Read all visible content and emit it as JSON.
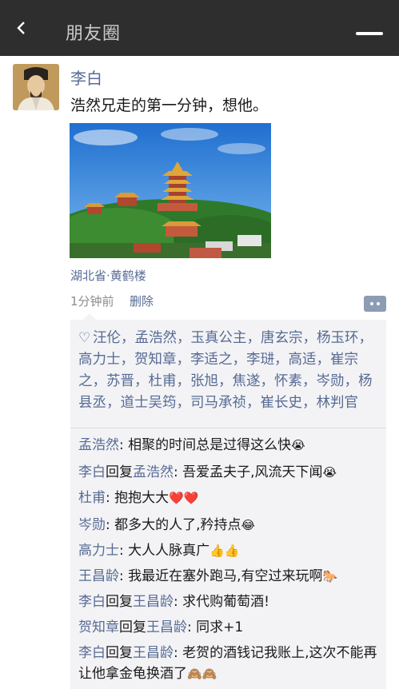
{
  "header": {
    "title": "朋友圈"
  },
  "post": {
    "author": "李白",
    "text": "浩然兄走的第一分钟，想他。",
    "location": "湖北省·黄鹤楼",
    "time": "1分钟前",
    "delete_label": "删除"
  },
  "likes": {
    "names": "汪伦，孟浩然，玉真公主，唐玄宗，杨玉环，高力士，贺知章，李适之，李琎，高适，崔宗之，苏晋，杜甫，张旭，焦遂，怀素，岑勋，杨县丞，道士吴筠，司马承祯，崔长史，林判官"
  },
  "comments": [
    {
      "author": "孟浩然",
      "reply": "",
      "sep": ": ",
      "text": "相聚的时间总是过得这么快",
      "emoji": "😭"
    },
    {
      "author": "李白",
      "reply_word": "回复",
      "reply": "孟浩然",
      "sep": ": ",
      "text": "吾爱孟夫子,风流天下闻",
      "emoji": "😭"
    },
    {
      "author": "杜甫",
      "reply": "",
      "sep": ": ",
      "text": "抱抱大大",
      "emoji": "❤️❤️"
    },
    {
      "author": "岑勋",
      "reply": "",
      "sep": ": ",
      "text": "都多大的人了,矜持点",
      "emoji": "😂"
    },
    {
      "author": "高力士",
      "reply": "",
      "sep": ": ",
      "text": "大人人脉真广",
      "emoji": "👍👍"
    },
    {
      "author": "王昌龄",
      "reply": "",
      "sep": ": ",
      "text": "我最近在塞外跑马,有空过来玩啊",
      "emoji": "🐎"
    },
    {
      "author": "李白",
      "reply_word": "回复",
      "reply": "王昌龄",
      "sep": ": ",
      "text": "求代购葡萄酒!",
      "emoji": ""
    },
    {
      "author": "贺知章",
      "reply_word": "回复",
      "reply": "王昌龄",
      "sep": ": ",
      "text": "同求+1",
      "emoji": ""
    },
    {
      "author": "李白",
      "reply_word": "回复",
      "reply": "王昌龄",
      "sep": ": ",
      "text": "老贺的酒钱记我账上,这次不能再让他拿金龟换酒了",
      "emoji": "🙈🙈"
    }
  ]
}
